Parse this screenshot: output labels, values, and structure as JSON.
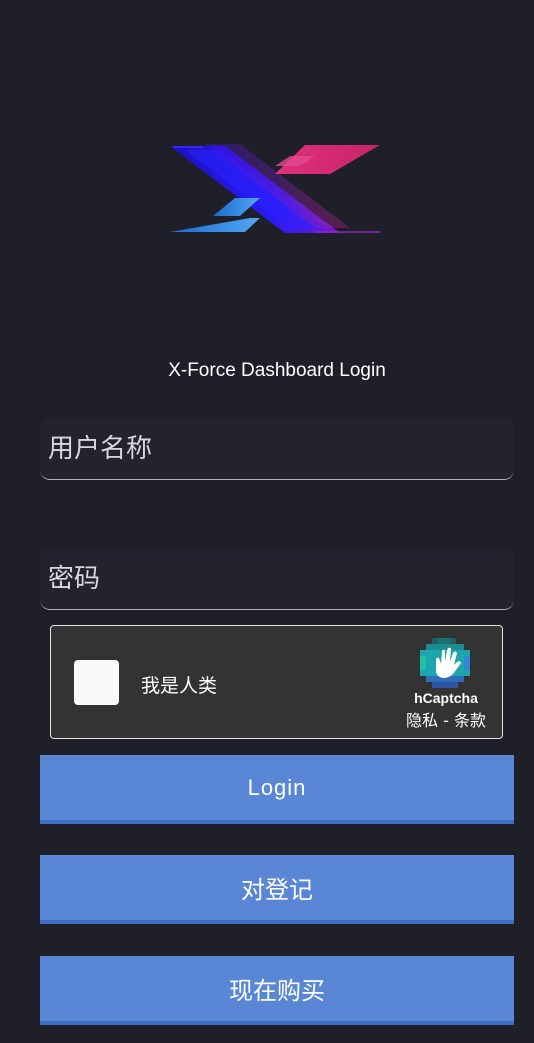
{
  "login": {
    "title": "X-Force Dashboard Login",
    "username_placeholder": "用户名称",
    "password_placeholder": "密码"
  },
  "captcha": {
    "label": "我是人类",
    "brand": "hCaptcha",
    "privacy_link": "隐私",
    "separator": " - ",
    "terms_link": "条款"
  },
  "buttons": {
    "login": "Login",
    "register": "对登记",
    "buy_now": "现在购买"
  },
  "colors": {
    "background": "#1f1f29",
    "field_background": "#22232f",
    "button": "#5a86d6",
    "captcha_panel": "#333333"
  },
  "icons": {
    "logo": "x-force-logo",
    "captcha": "hcaptcha-hand-icon"
  }
}
